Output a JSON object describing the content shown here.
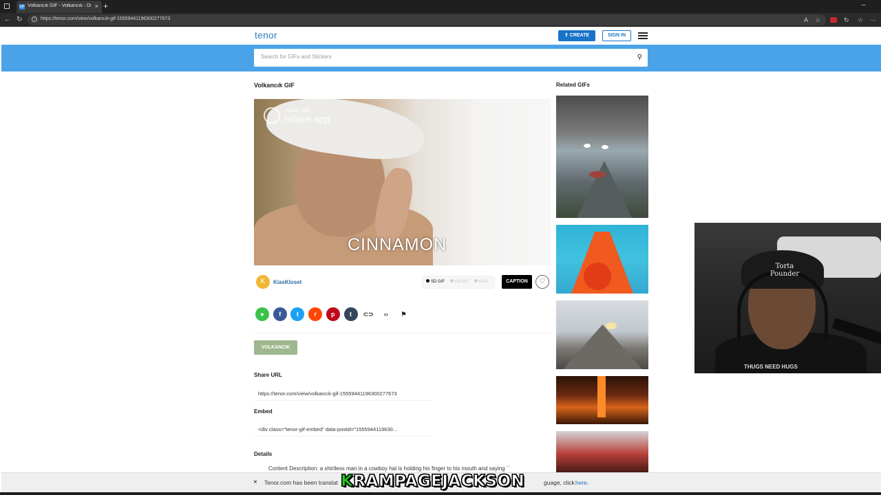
{
  "browser": {
    "tab_title": "Volkancık GIF - Volkancık - Disco",
    "tab_favicon": "GIF",
    "url": "https://tenor.com/view/volkancık-gif-15559441196300277673",
    "new_tab_symbol": "+",
    "close_symbol": "×"
  },
  "header": {
    "logo": "tenor",
    "create_label": "CREATE",
    "signin_label": "SIGN IN",
    "brand_color": "#1774c8"
  },
  "search": {
    "placeholder": "Search for GIFs and Stickers",
    "value": ""
  },
  "gif": {
    "title": "Volkancık GIF",
    "watermark_small": "made with",
    "watermark_large": "reface app",
    "caption_text": "CINNAMON"
  },
  "author": {
    "initial": "K",
    "name": "KiasKloset"
  },
  "formats": [
    {
      "label": "SD GIF",
      "active": true
    },
    {
      "label": "HD GIF",
      "active": false
    },
    {
      "label": "MP4",
      "active": false
    }
  ],
  "actions": {
    "caption_label": "CAPTION",
    "favorite_icon": "heart-icon"
  },
  "share_icons": [
    {
      "name": "message-icon",
      "glyph": "●",
      "color": "#3ac34b"
    },
    {
      "name": "facebook-icon",
      "glyph": "f",
      "color": "#3b5998"
    },
    {
      "name": "twitter-icon",
      "glyph": "t",
      "color": "#1da1f2"
    },
    {
      "name": "reddit-icon",
      "glyph": "r",
      "color": "#ff4500"
    },
    {
      "name": "pinterest-icon",
      "glyph": "p",
      "color": "#bd081c"
    },
    {
      "name": "tumblr-icon",
      "glyph": "t",
      "color": "#35465c"
    },
    {
      "name": "link-icon",
      "glyph": "⊂⊃",
      "color": "#ffffff"
    },
    {
      "name": "embed-icon",
      "glyph": "‹›",
      "color": "#ffffff"
    },
    {
      "name": "flag-icon",
      "glyph": "⚑",
      "color": "#ffffff"
    }
  ],
  "tag": "VOLKANCIK",
  "share_url": {
    "label": "Share URL",
    "value": "https://tenor.com/view/volkancık-gif-15559441196300277673"
  },
  "embed": {
    "label": "Embed",
    "value": "<div class=\"tenor-gif-embed\" data-postid=\"1555944119630..."
  },
  "details": {
    "label": "Details",
    "content": "Content Description: a shirtless man in a cowboy hat is holding his finger to his mouth and saying ``"
  },
  "related": {
    "label": "Related GIFs"
  },
  "webcam": {
    "hat_text": "Torta Pounder",
    "shirt_text": "THUGS NEED HUGS"
  },
  "banner": {
    "close_symbol": "×",
    "text_start": "Tenor.com has been translat",
    "text_end": "guage, click",
    "link_text": "here",
    "text_period": "."
  },
  "overlay": {
    "name_first": "K",
    "name_rest": "RAMPAGEJACKSON"
  }
}
